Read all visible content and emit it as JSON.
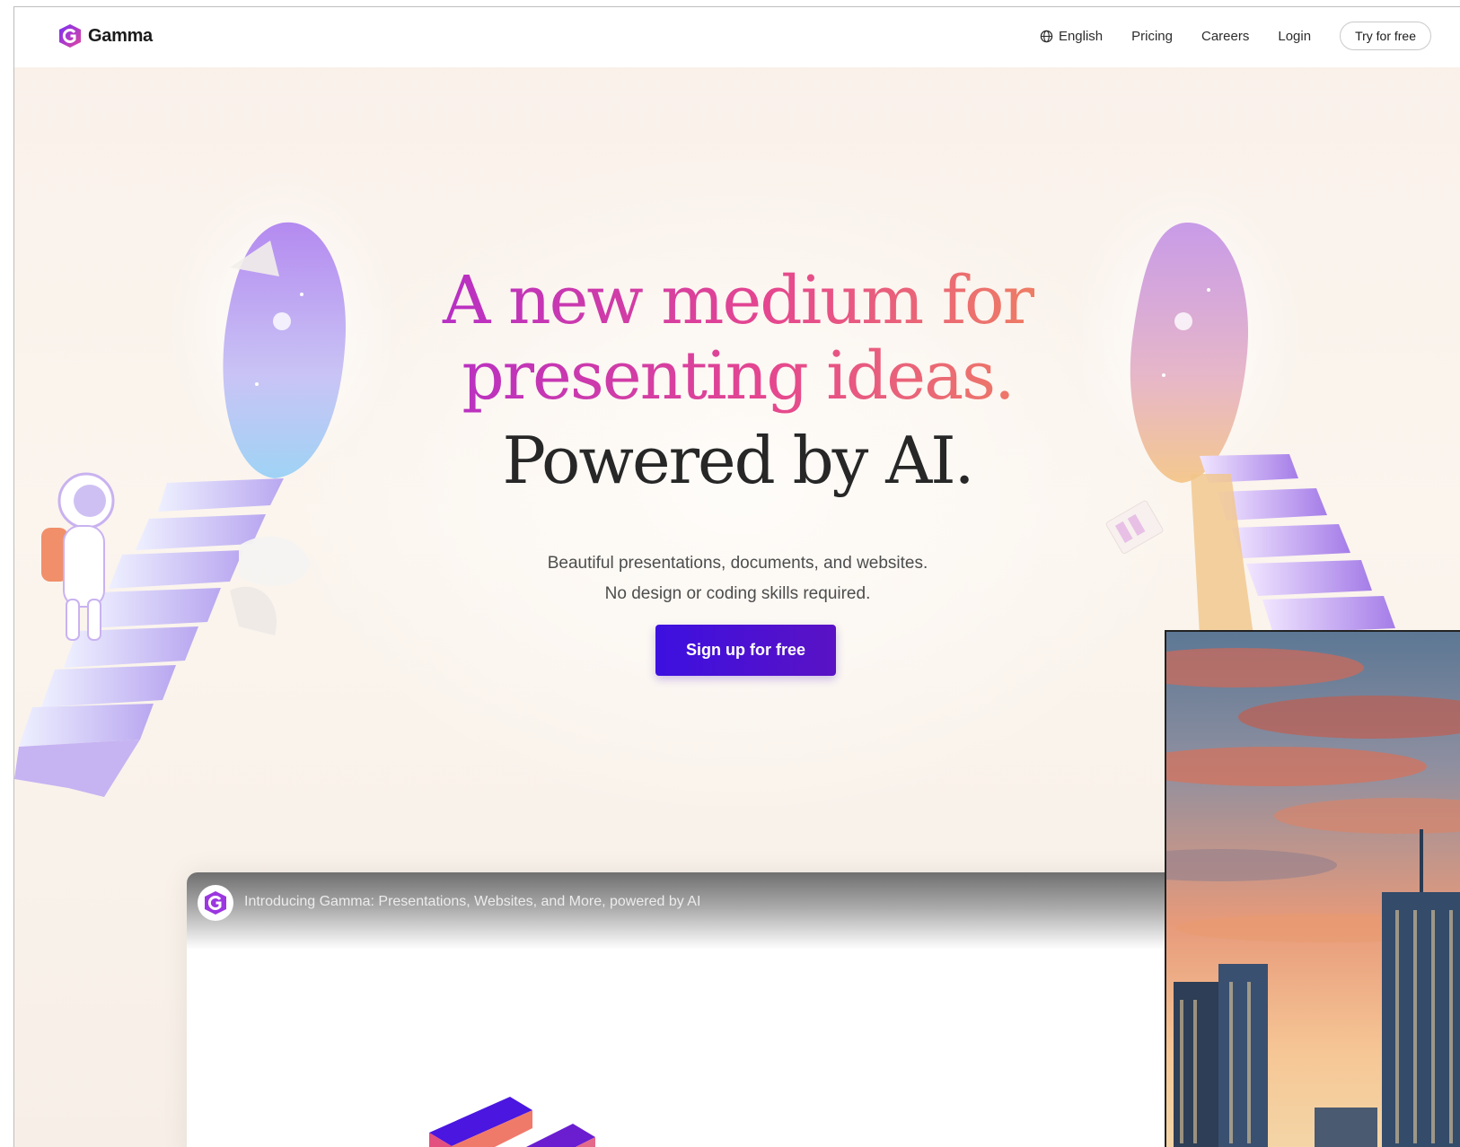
{
  "nav": {
    "brand": "Gamma",
    "language": "English",
    "links": [
      "Pricing",
      "Careers",
      "Login"
    ],
    "cta": "Try for free"
  },
  "hero": {
    "headline_line1": "A new medium for",
    "headline_line2": "presenting ideas.",
    "headline_line3": "Powered by AI.",
    "subtitle_line1": "Beautiful presentations, documents, and websites.",
    "subtitle_line2": "No design or coding skills required.",
    "signup_label": "Sign up for free"
  },
  "video": {
    "title": "Introducing Gamma: Presentations, Websites, and More, powered by AI"
  },
  "colors": {
    "accent": "#4b12d8",
    "gradient_start": "#6a22d8",
    "gradient_end": "#f2a25d",
    "text_dark": "#272727"
  }
}
